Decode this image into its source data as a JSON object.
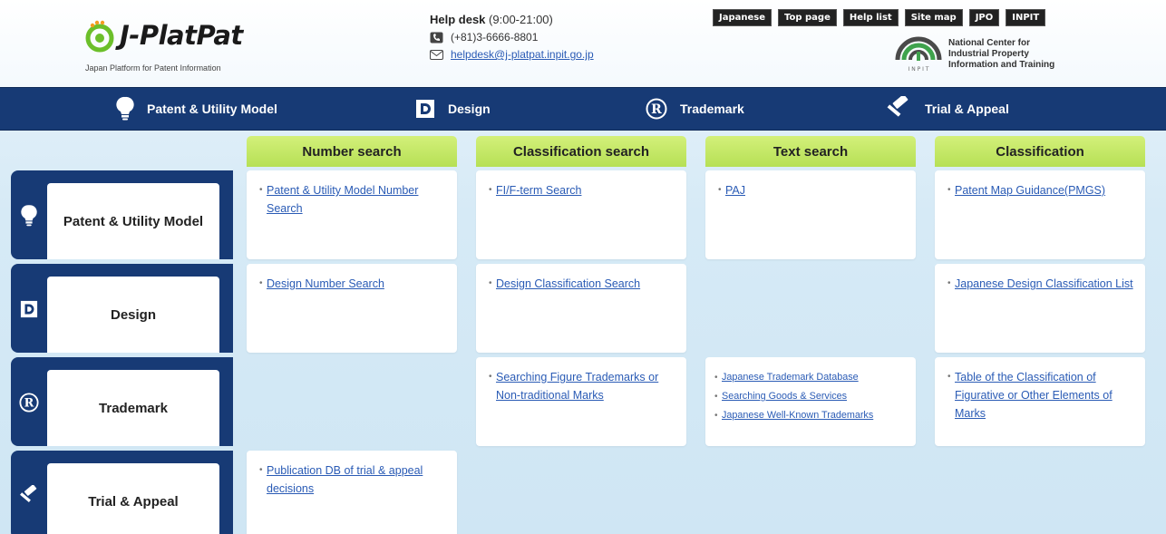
{
  "header": {
    "logo_text": "J-PlatPat",
    "logo_subtitle": "Japan Platform for Patent Information",
    "helpdesk": {
      "title": "Help desk",
      "hours": "(9:00-21:00)",
      "phone": "(+81)3-6666-8801",
      "email": "helpdesk@j-platpat.inpit.go.jp"
    },
    "top_links": [
      "Japanese",
      "Top page",
      "Help list",
      "Site map",
      "JPO",
      "INPIT"
    ],
    "inpit": {
      "mark_text": "I N P I T",
      "line1": "National Center for",
      "line2": "Industrial Property",
      "line3": "Information and Training"
    }
  },
  "nav": {
    "items": [
      {
        "label": "Patent & Utility Model",
        "icon": "lightbulb-icon"
      },
      {
        "label": "Design",
        "icon": "design-d-icon"
      },
      {
        "label": "Trademark",
        "icon": "registered-r-icon"
      },
      {
        "label": "Trial & Appeal",
        "icon": "gavel-icon"
      }
    ]
  },
  "columns": [
    "Number search",
    "Classification search",
    "Text search",
    "Classification"
  ],
  "rows": [
    {
      "label": "Patent & Utility Model",
      "icon": "lightbulb-icon",
      "cells": [
        [
          "Patent & Utility Model Number Search"
        ],
        [
          "FI/F-term Search"
        ],
        [
          "PAJ"
        ],
        [
          "Patent Map Guidance(PMGS)"
        ]
      ]
    },
    {
      "label": "Design",
      "icon": "design-d-icon",
      "cells": [
        [
          "Design Number Search"
        ],
        [
          "Design Classification Search"
        ],
        [],
        [
          "Japanese Design Classification List"
        ]
      ]
    },
    {
      "label": "Trademark",
      "icon": "registered-r-icon",
      "cells": [
        [],
        [
          "Searching Figure Trademarks or Non-traditional Marks"
        ],
        [
          "Japanese Trademark Database",
          "Searching Goods & Services",
          "Japanese Well-Known Trademarks"
        ],
        [
          "Table of the Classification of Figurative or Other Elements of Marks"
        ]
      ]
    },
    {
      "label": "Trial & Appeal",
      "icon": "gavel-icon",
      "cells": [
        [
          "Publication DB of trial & appeal decisions"
        ],
        [],
        [],
        []
      ]
    }
  ],
  "colors": {
    "navy": "#173a75",
    "lime_header": "#c3e765",
    "link": "#2a5bb5"
  }
}
